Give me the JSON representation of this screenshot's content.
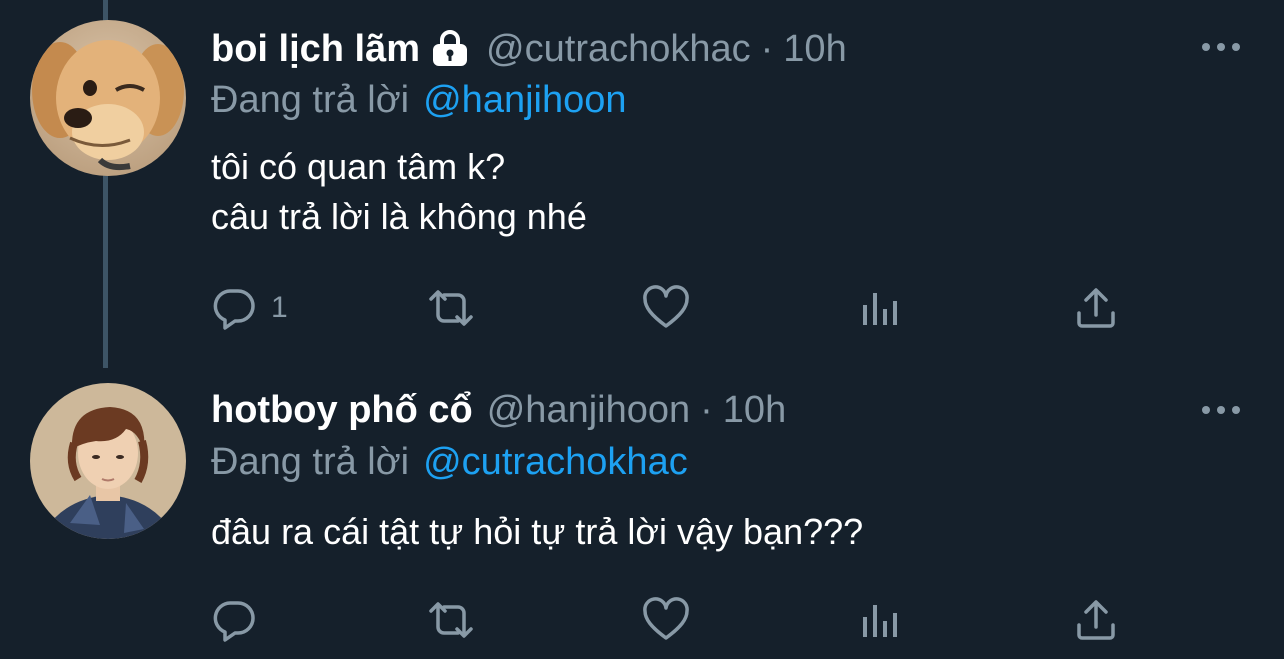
{
  "colors": {
    "background": "#15202b",
    "secondary_text": "#8899a6",
    "link": "#1da1f2",
    "thread_line": "#3d5466"
  },
  "tweets": [
    {
      "display_name": "boi lịch lãm",
      "protected": true,
      "handle": "@cutrachokhac",
      "separator": "·",
      "time": "10h",
      "reply_prefix": "Đang trả lời",
      "reply_to": "@hanjihoon",
      "lines": [
        "tôi có quan tâm k?",
        "câu trả lời là không nhé"
      ],
      "reply_count": "1",
      "avatar": "dog-avatar"
    },
    {
      "display_name": "hotboy phố cổ",
      "protected": false,
      "handle": "@hanjihoon",
      "separator": "·",
      "time": "10h",
      "reply_prefix": "Đang trả lời",
      "reply_to": "@cutrachokhac",
      "lines": [
        "đâu ra cái tật tự hỏi tự trả lời vậy bạn???"
      ],
      "reply_count": "",
      "avatar": "person-avatar"
    }
  ],
  "icons": {
    "reply": "comment-bubble-icon",
    "retweet": "retweet-icon",
    "like": "heart-icon",
    "analytics": "analytics-bars-icon",
    "share": "share-upload-icon",
    "more": "more-dots-icon",
    "lock": "lock-icon"
  }
}
